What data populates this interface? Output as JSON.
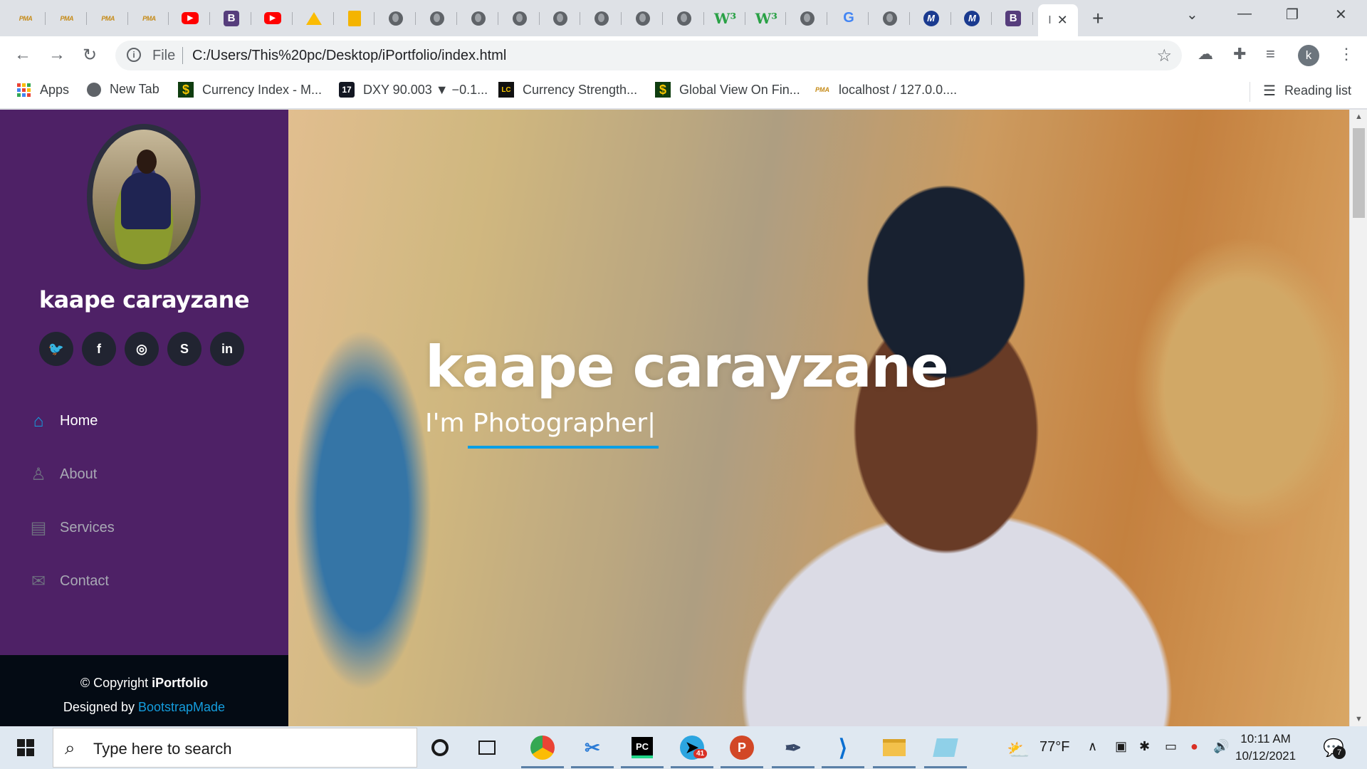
{
  "browser": {
    "tabs": [
      {
        "icon": "pma-icon",
        "glyph": "PMA"
      },
      {
        "icon": "pma-icon",
        "glyph": "PMA"
      },
      {
        "icon": "pma-icon",
        "glyph": "PMA"
      },
      {
        "icon": "pma-icon",
        "glyph": "PMA"
      },
      {
        "icon": "youtube-icon",
        "glyph": "▶"
      },
      {
        "icon": "bootstrap-icon",
        "glyph": "B"
      },
      {
        "icon": "youtube-icon",
        "glyph": "▶"
      },
      {
        "icon": "google-drive-icon",
        "glyph": ""
      },
      {
        "icon": "google-slides-icon",
        "glyph": ""
      },
      {
        "icon": "globe-icon",
        "glyph": ""
      },
      {
        "icon": "globe-icon",
        "glyph": ""
      },
      {
        "icon": "globe-icon",
        "glyph": ""
      },
      {
        "icon": "globe-icon",
        "glyph": ""
      },
      {
        "icon": "globe-icon",
        "glyph": ""
      },
      {
        "icon": "globe-icon",
        "glyph": ""
      },
      {
        "icon": "globe-icon",
        "glyph": ""
      },
      {
        "icon": "globe-icon",
        "glyph": ""
      },
      {
        "icon": "w3schools-icon",
        "glyph": "W³"
      },
      {
        "icon": "w3schools-icon",
        "glyph": "W³"
      },
      {
        "icon": "globe-icon",
        "glyph": ""
      },
      {
        "icon": "google-icon",
        "glyph": "G"
      },
      {
        "icon": "globe-icon",
        "glyph": ""
      },
      {
        "icon": "m-icon",
        "glyph": "M"
      },
      {
        "icon": "m-icon",
        "glyph": "M"
      },
      {
        "icon": "bootstrap-icon",
        "glyph": "B"
      }
    ],
    "active_tab_glyph": "I",
    "close_glyph": "✕",
    "new_tab_glyph": "+",
    "address": {
      "scheme_label": "File",
      "url": "C:/Users/This%20pc/Desktop/iPortfolio/index.html"
    },
    "bookmarks": [
      {
        "label": "Apps",
        "icon": "apps-grid-icon"
      },
      {
        "label": "New Tab",
        "icon": "globe-icon"
      },
      {
        "label": "Currency Index - M...",
        "icon": "dollar-icon"
      },
      {
        "label": "DXY 90.003 ▼ −0.1...",
        "icon": "tradingview-icon"
      },
      {
        "label": "Currency Strength...",
        "icon": "lc-icon"
      },
      {
        "label": "Global View On Fin...",
        "icon": "dollar-icon"
      },
      {
        "label": "localhost / 127.0.0....",
        "icon": "pma-icon"
      }
    ],
    "reading_list": "Reading list",
    "profile_initial": "k"
  },
  "page": {
    "sidebar": {
      "name": "kaape carayzane",
      "socials": [
        {
          "icon": "twitter-icon",
          "glyph": "🐦"
        },
        {
          "icon": "facebook-icon",
          "glyph": "f"
        },
        {
          "icon": "instagram-icon",
          "glyph": "◎"
        },
        {
          "icon": "skype-icon",
          "glyph": "S"
        },
        {
          "icon": "linkedin-icon",
          "glyph": "in"
        }
      ],
      "nav": [
        {
          "label": "Home",
          "icon": "home-icon",
          "active": true
        },
        {
          "label": "About",
          "icon": "person-icon",
          "active": false
        },
        {
          "label": "Services",
          "icon": "server-icon",
          "active": false
        },
        {
          "label": "Contact",
          "icon": "envelope-icon",
          "active": false
        }
      ],
      "footer": {
        "copyright_prefix": "© Copyright ",
        "brand": "iPortfolio",
        "designed_prefix": "Designed by ",
        "designer": "BootstrapMade"
      }
    },
    "hero": {
      "title": "kaape carayzane",
      "subtitle": "I'm Photographer|"
    },
    "colors": {
      "sidebar_bg": "#4e2166",
      "accent": "#149ddd",
      "footer_bg": "#040b14"
    }
  },
  "taskbar": {
    "search_placeholder": "Type here to search",
    "apps": [
      {
        "icon": "cortana-icon"
      },
      {
        "icon": "task-view-icon"
      },
      {
        "icon": "chrome-icon"
      },
      {
        "icon": "snipping-tool-icon"
      },
      {
        "icon": "pycharm-icon",
        "glyph": "PC"
      },
      {
        "icon": "telegram-icon",
        "badge": "41"
      },
      {
        "icon": "powerpoint-icon",
        "glyph": "P"
      },
      {
        "icon": "feather-pen-icon"
      },
      {
        "icon": "vscode-icon"
      },
      {
        "icon": "file-explorer-icon"
      },
      {
        "icon": "notepad-icon"
      }
    ],
    "weather": "77°F",
    "time": "10:11 AM",
    "date": "10/12/2021",
    "notification_count": "7"
  }
}
